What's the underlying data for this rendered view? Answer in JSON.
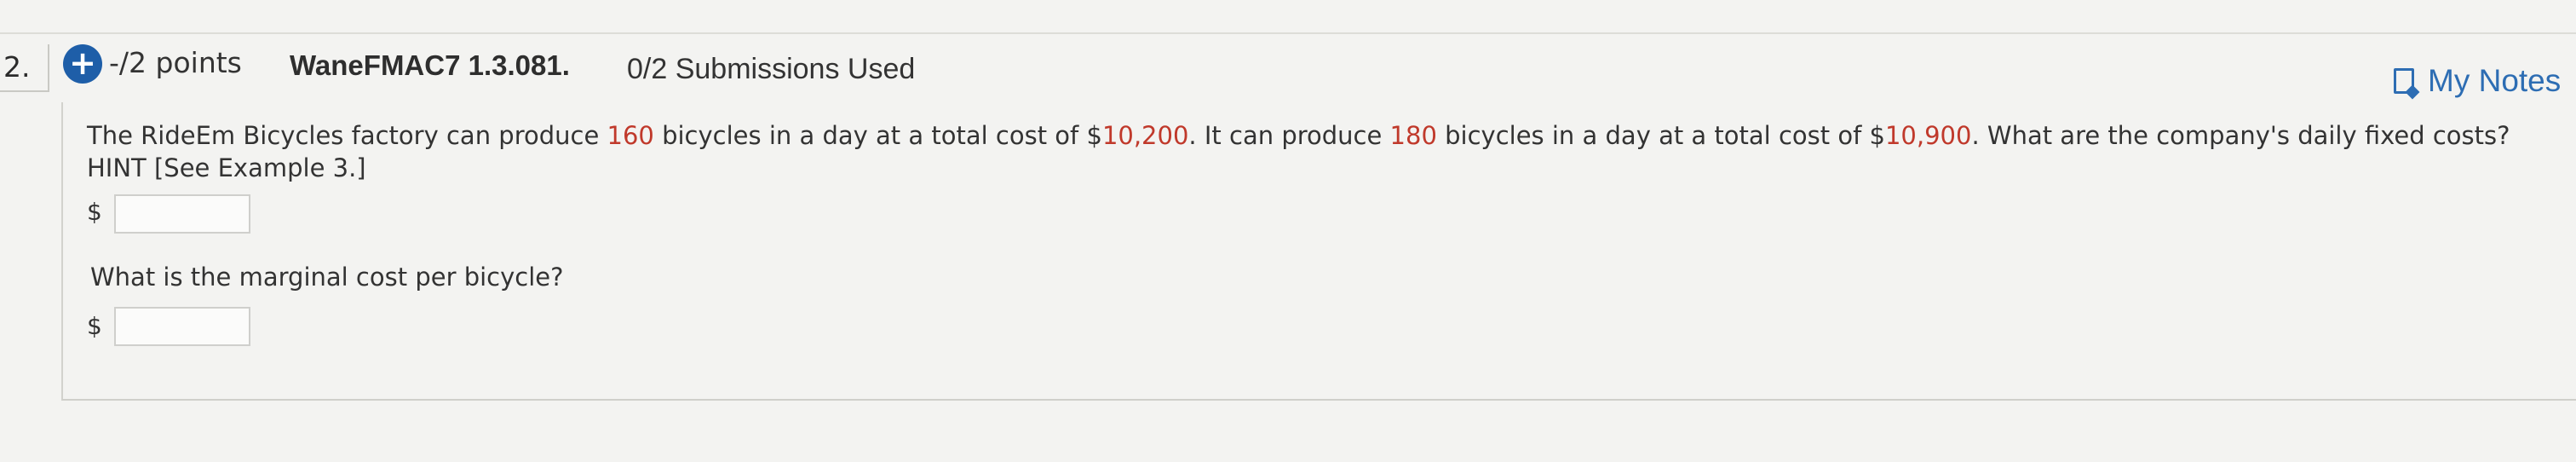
{
  "question": {
    "number": "2.",
    "points": "-/2 points",
    "code": "WaneFMAC7 1.3.081.",
    "submissions": "0/2 Submissions Used",
    "notes_label": "My Notes",
    "text_parts": [
      "The RideEm Bicycles factory can produce ",
      "160",
      " bicycles in a day at a total cost of $",
      "10,200",
      ". It can produce ",
      "180",
      " bicycles in a day at a total cost of $",
      "10,900",
      ". What are the company's daily fixed costs?"
    ],
    "hint": "HINT [See Example 3.]",
    "part1_prefix": "$",
    "part1_value": "",
    "part2_text": "What is the marginal cost per bicycle?",
    "part2_prefix": "$",
    "part2_value": ""
  },
  "colors": {
    "highlight": "#c0392b",
    "link": "#2d6db3",
    "badge": "#1e5ea8"
  },
  "icons": {
    "points_badge": "plus-circle-icon",
    "notes": "notes-icon"
  }
}
